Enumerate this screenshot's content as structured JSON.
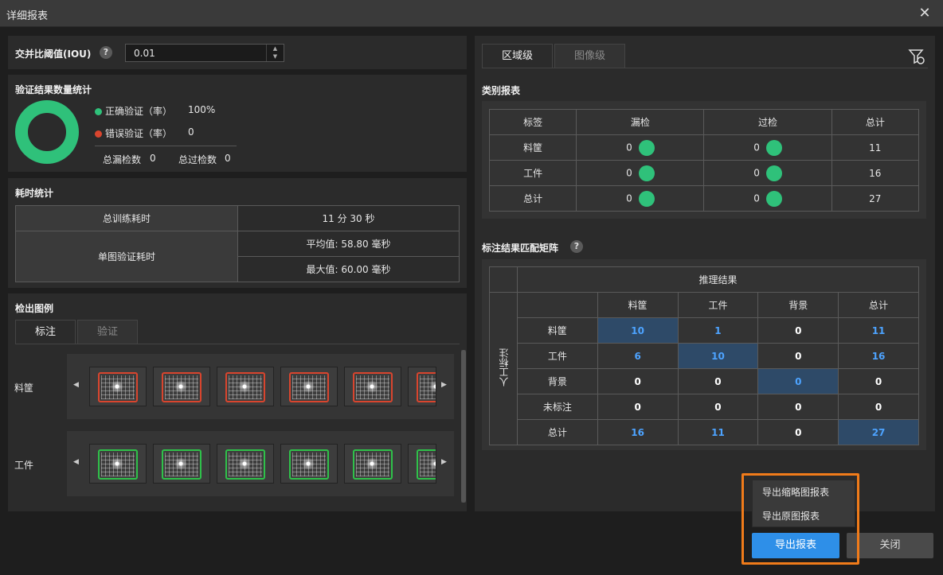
{
  "window": {
    "title": "详细报表"
  },
  "iou": {
    "label": "交并比阈值(IOU)",
    "help": "?",
    "value": "0.01"
  },
  "verify_stats": {
    "title": "验证结果数量统计",
    "correct_label": "正确验证（率）",
    "correct_value": "100%",
    "wrong_label": "错误验证（率）",
    "wrong_value": "0",
    "missed_label": "总漏检数",
    "missed_value": "0",
    "over_label": "总过检数",
    "over_value": "0",
    "correct_color": "#2fc17a",
    "wrong_color": "#d9452e"
  },
  "time_stats": {
    "title": "耗时统计",
    "train_label": "总训练耗时",
    "train_value": "11 分 30 秒",
    "single_label": "单图验证耗时",
    "avg_value": "平均值: 58.80 毫秒",
    "max_value": "最大值: 60.00 毫秒"
  },
  "examples": {
    "title": "检出图例",
    "tabs": [
      "标注",
      "验证"
    ],
    "rows": [
      {
        "label": "料筐",
        "color": "#d9452e"
      },
      {
        "label": "工件",
        "color": "#2fc14a"
      }
    ]
  },
  "right_tabs": [
    "区域级",
    "图像级"
  ],
  "category_report": {
    "title": "类别报表",
    "headers": [
      "标签",
      "漏检",
      "过检",
      "总计"
    ],
    "rows": [
      {
        "label": "料筐",
        "missed": "0",
        "over": "0",
        "total": "11"
      },
      {
        "label": "工件",
        "missed": "0",
        "over": "0",
        "total": "16"
      },
      {
        "label": "总计",
        "missed": "0",
        "over": "0",
        "total": "27"
      }
    ]
  },
  "matrix": {
    "title": "标注结果匹配矩阵",
    "help": "?",
    "top_header": "推理结果",
    "side_header": "人工标注",
    "cols": [
      "料筐",
      "工件",
      "背景",
      "总计"
    ],
    "rows": [
      {
        "label": "料筐",
        "values": [
          "10",
          "1",
          "0",
          "11"
        ]
      },
      {
        "label": "工件",
        "values": [
          "6",
          "10",
          "0",
          "16"
        ]
      },
      {
        "label": "背景",
        "values": [
          "0",
          "0",
          "0",
          "0"
        ]
      },
      {
        "label": "未标注",
        "values": [
          "0",
          "0",
          "0",
          "0"
        ]
      },
      {
        "label": "总计",
        "values": [
          "16",
          "11",
          "0",
          "27"
        ]
      }
    ]
  },
  "export_menu": {
    "thumb_report": "导出缩略图报表",
    "original_report": "导出原图报表"
  },
  "buttons": {
    "export": "导出报表",
    "close": "关闭"
  }
}
